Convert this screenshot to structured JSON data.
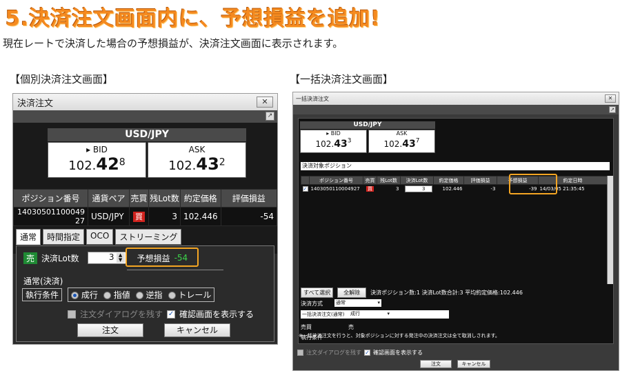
{
  "headline": "5.決済注文画面内に、予想損益を追加!",
  "subline": "現在レートで決済した場合の予想損益が、決済注文画面に表示されます。",
  "captions": {
    "left": "【個別決済注文画面】",
    "right": "【一括決済注文画面】"
  },
  "left_window": {
    "title": "決済注文",
    "close": "✕",
    "pop": "↗",
    "pair": "USD/JPY",
    "bid": {
      "label": "BID",
      "prefix": "102.",
      "big": "42",
      "sup": "8"
    },
    "ask": {
      "label": "ASK",
      "prefix": "102.",
      "big": "43",
      "sup": "2"
    },
    "headers": [
      "ポジション番号",
      "通貨ペア",
      "売買",
      "残Lot数",
      "約定価格",
      "評価損益"
    ],
    "row": {
      "position_no": "14030501100049​27",
      "pair": "USD/JPY",
      "side": "買",
      "lots": "3",
      "price": "102.446",
      "pl": "-54"
    },
    "tabs": [
      "通常",
      "時間指定",
      "OCO",
      "ストリーミング"
    ],
    "side_badge": "売",
    "lot_label": "決済Lot数",
    "lot_value": "3",
    "expected_pl_label": "予想損益",
    "expected_pl_value": "-54",
    "section_label": "通常(決済)",
    "exec_label": "執行条件",
    "exec_options": [
      "成行",
      "指値",
      "逆指",
      "トレール"
    ],
    "dialog_skip": "注文ダイアログを残す",
    "confirm_show": "確認画面を表示する",
    "order_button": "注文",
    "cancel_button": "キャンセル"
  },
  "right_window": {
    "title": "一括決済注文",
    "close": "✕",
    "pop": "↗",
    "pair": "USD/JPY",
    "bid": {
      "label": "BID",
      "prefix": "102.",
      "big": "43",
      "sup": "3"
    },
    "ask": {
      "label": "ASK",
      "prefix": "102.",
      "big": "43",
      "sup": "7"
    },
    "positions_label": "決済対象ポジション",
    "headers": [
      "",
      "ポジション番号",
      "売買",
      "残Lot数",
      "決済Lot数",
      "約定価格",
      "評価損益",
      "予想損益",
      "約定日時"
    ],
    "row": {
      "position_no": "1403050110004927",
      "side": "買",
      "lots": "3",
      "close_lots": "3",
      "price": "102.446",
      "pl": "-3",
      "expected_pl": "-39",
      "datetime": "14/03/05 21:35:45"
    },
    "select_all": "すべて選択",
    "clear_all": "全解除",
    "summary": "決済ポジション数:1  決済Lot数合計:3  平均約定価格:102.446",
    "method_label": "決済方式",
    "method_value": "通常",
    "method_name": "一括決済注文(通常)",
    "side_label": "売買",
    "side_value": "売",
    "exec_label": "執行条件",
    "exec_value": "成行",
    "note": "※一括決済注文を行うと、対象ポジションに対する発注中の決済注文は全て取消しされます。",
    "dialog_skip": "注文ダイアログを残す",
    "confirm_show": "確認画面を表示する",
    "order_button": "注文",
    "cancel_button": "キャンセル"
  },
  "colors": {
    "accent": "#f58a1f",
    "highlight": "#f5a623",
    "buy": "#d0231e",
    "sell": "#1f8a34",
    "pair_yellow": "#f2d72c",
    "pl_green": "#3cd64a"
  }
}
